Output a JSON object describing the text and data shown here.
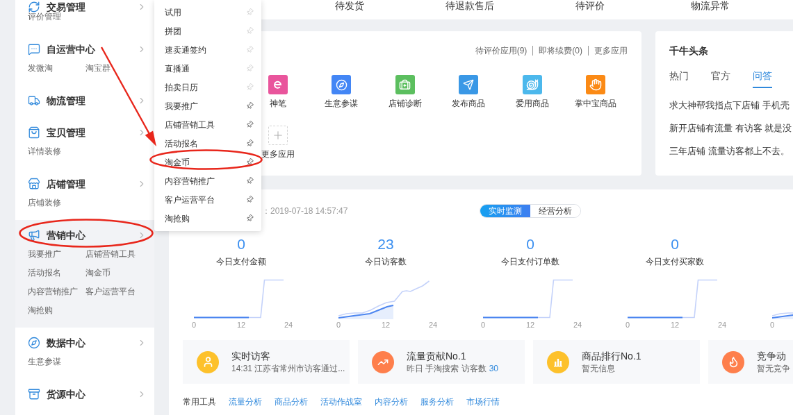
{
  "sidebar": {
    "groups": [
      {
        "title": "交易管理",
        "subs": [
          "评价管理"
        ],
        "selected": false,
        "circled": false
      },
      {
        "title": "自运营中心",
        "subs": [
          "发微淘",
          "淘宝群"
        ],
        "selected": false,
        "circled": false
      },
      {
        "title": "物流管理",
        "selected": false,
        "circled": false
      },
      {
        "title": "宝贝管理",
        "subs": [
          "详情装修"
        ],
        "selected": false,
        "circled": false
      },
      {
        "title": "店铺管理",
        "subs": [
          "店铺装修"
        ],
        "selected": false,
        "circled": false
      },
      {
        "title": "营销中心",
        "subs": [
          "我要推广",
          "店铺营销工具",
          "活动报名",
          "淘金币",
          "内容营销推广",
          "客户运营平台",
          "淘抢购"
        ],
        "selected": true,
        "circled": true
      },
      {
        "title": "数据中心",
        "subs": [
          "生意参谋"
        ],
        "selected": false,
        "circled": false
      },
      {
        "title": "货源中心",
        "selected": false,
        "circled": false
      }
    ]
  },
  "flyout": {
    "items": [
      {
        "label": "试用",
        "pinned": false,
        "circled": false
      },
      {
        "label": "拼团",
        "pinned": false,
        "circled": false
      },
      {
        "label": "速卖通签约",
        "pinned": false,
        "circled": false
      },
      {
        "label": "直播通",
        "pinned": false,
        "circled": false
      },
      {
        "label": "拍卖日历",
        "pinned": false,
        "circled": false
      },
      {
        "label": "我要推广",
        "pinned": true,
        "circled": false
      },
      {
        "label": "店铺营销工具",
        "pinned": true,
        "circled": false
      },
      {
        "label": "活动报名",
        "pinned": true,
        "circled": false
      },
      {
        "label": "淘金币",
        "pinned": true,
        "circled": true
      },
      {
        "label": "内容营销推广",
        "pinned": true,
        "circled": false
      },
      {
        "label": "客户运营平台",
        "pinned": true,
        "circled": false
      },
      {
        "label": "淘抢购",
        "pinned": true,
        "circled": false
      }
    ]
  },
  "order_status": [
    "待发货",
    "待退款售后",
    "待评价",
    "物流异常"
  ],
  "apps": {
    "links": [
      "待评价应用(9)",
      "即将续费(0)",
      "更多应用"
    ],
    "items": [
      "神笔",
      "生意参谋",
      "店铺诊断",
      "发布商品",
      "爱用商品",
      "掌中宝商品"
    ],
    "add_label": "更多应用"
  },
  "news": {
    "title": "千牛头条",
    "tabs": [
      {
        "label": "热门",
        "selected": false
      },
      {
        "label": "官方",
        "selected": false
      },
      {
        "label": "问答",
        "selected": true
      }
    ],
    "items": [
      "求大神帮我指点下店铺 手机壳",
      "新开店铺有流量 有访客 就是没",
      "三年店铺 流量访客都上不去。"
    ]
  },
  "monitor": {
    "updated": "：2019-07-18 14:57:47",
    "modes": [
      {
        "label": "实时监测",
        "selected": true
      },
      {
        "label": "经营分析",
        "selected": false
      }
    ],
    "metrics": [
      {
        "value": "0",
        "label": "今日支付金额",
        "kind": "step",
        "ticks": [
          "0",
          "12",
          "24"
        ]
      },
      {
        "value": "23",
        "label": "今日访客数",
        "kind": "growth",
        "ticks": [
          "0",
          "12",
          "24"
        ]
      },
      {
        "value": "0",
        "label": "今日支付订单数",
        "kind": "step",
        "ticks": [
          "0",
          "12",
          "24"
        ]
      },
      {
        "value": "0",
        "label": "今日支付买家数",
        "kind": "step",
        "ticks": [
          "0",
          "12",
          "24"
        ]
      },
      {
        "kind": "growth",
        "ticks": [
          "0"
        ]
      }
    ],
    "cards": [
      {
        "title": "实时访客",
        "detail": "14:31 江苏省常州市访客通过..."
      },
      {
        "title": "流量贡献No.1",
        "detail": "昨日 手淘搜索 访客数",
        "count": "30"
      },
      {
        "title": "商品排行No.1",
        "detail": "暂无信息"
      },
      {
        "title": "竞争动",
        "detail": "暂无竞争"
      }
    ],
    "tools": {
      "label": "常用工具",
      "links": [
        "流量分析",
        "商品分析",
        "活动作战室",
        "内容分析",
        "服务分析",
        "市场行情"
      ]
    }
  },
  "annotation": {
    "arrow": true
  }
}
